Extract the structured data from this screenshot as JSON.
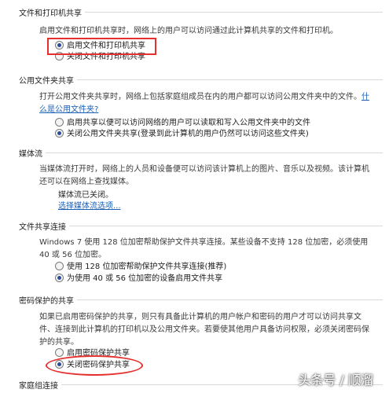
{
  "sections": {
    "file_printer": {
      "title": "文件和打印机共享",
      "desc": "启用文件和打印机共享时，网络上的用户可以访问通过此计算机共享的文件和打印机。",
      "options": [
        "启用文件和打印机共享",
        "关闭文件和打印机共享"
      ]
    },
    "public_folder": {
      "title": "公用文件夹共享",
      "desc": "打开公用文件夹共享时，网络上包括家庭组成员在内的用户都可以访问公用文件夹中的文件。",
      "link": "什么是公用文件夹?",
      "options": [
        "启用共享以便可以访问网络的用户可以读取和写入公用文件夹中的文件",
        "关闭公用文件夹共享(登录到此计算机的用户仍然可以访问这些文件夹)"
      ]
    },
    "media": {
      "title": "媒体流",
      "desc": "当媒体流打开时，网络上的人员和设备便可以访问该计算机上的图片、音乐以及视频。该计算机还可以在网络上查找媒体。",
      "status": "媒体流已关闭。",
      "link": "选择媒体流选项..."
    },
    "connection": {
      "title": "文件共享连接",
      "desc": "Windows 7 使用 128 位加密帮助保护文件共享连接。某些设备不支持 128 位加密，必须使用 40 或 56 位加密。",
      "options": [
        "使用 128 位加密帮助保护文件共享连接(推荐)",
        "为使用 40 或 56 位加密的设备启用文件共享"
      ]
    },
    "password": {
      "title": "密码保护的共享",
      "desc": "如果已启用密码保护的共享，则只有具备此计算机的用户帐户和密码的用户才可以访问共享文件、连接到此计算机的打印机以及公用文件夹。若要使其他用户具备访问权限，必须关闭密码保护的共享。",
      "options": [
        "启用密码保护共享",
        "关闭密码保护共享"
      ]
    },
    "homegroup": {
      "title": "家庭组连接"
    }
  },
  "selected": {
    "file_printer": 0,
    "public_folder": 1,
    "connection": 1,
    "password": 1
  },
  "watermark": "头条号 / 顺溜",
  "colors": {
    "highlight": "#e53030",
    "link": "#1a5fb4"
  }
}
